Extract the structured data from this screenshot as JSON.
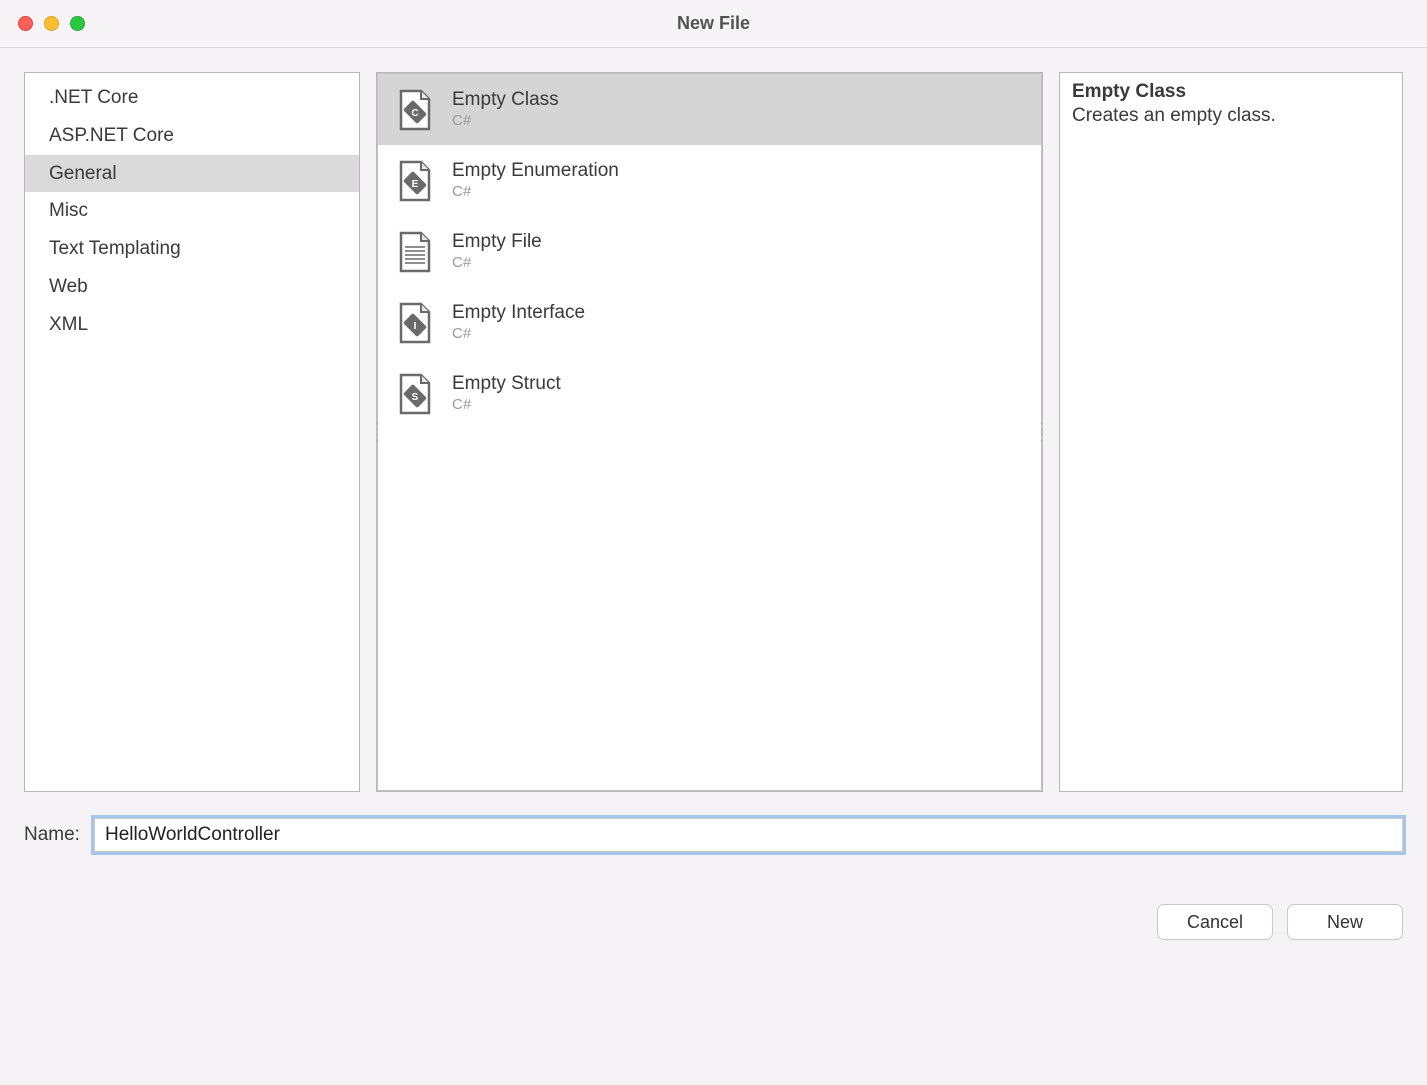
{
  "window": {
    "title": "New File"
  },
  "categories": {
    "items": [
      {
        "label": ".NET Core",
        "selected": false
      },
      {
        "label": "ASP.NET Core",
        "selected": false
      },
      {
        "label": "General",
        "selected": true
      },
      {
        "label": "Misc",
        "selected": false
      },
      {
        "label": "Text Templating",
        "selected": false
      },
      {
        "label": "Web",
        "selected": false
      },
      {
        "label": "XML",
        "selected": false
      }
    ]
  },
  "templates": {
    "items": [
      {
        "title": "Empty Class",
        "subtitle": "C#",
        "icon": "class-file-icon",
        "selected": true
      },
      {
        "title": "Empty Enumeration",
        "subtitle": "C#",
        "icon": "enum-file-icon",
        "selected": false
      },
      {
        "title": "Empty File",
        "subtitle": "C#",
        "icon": "text-file-icon",
        "selected": false
      },
      {
        "title": "Empty Interface",
        "subtitle": "C#",
        "icon": "interface-file-icon",
        "selected": false
      },
      {
        "title": "Empty Struct",
        "subtitle": "C#",
        "icon": "struct-file-icon",
        "selected": false
      }
    ]
  },
  "description": {
    "title": "Empty Class",
    "text": "Creates an empty class."
  },
  "form": {
    "name_label": "Name:",
    "name_value": "HelloWorldController"
  },
  "buttons": {
    "cancel": "Cancel",
    "new": "New"
  }
}
